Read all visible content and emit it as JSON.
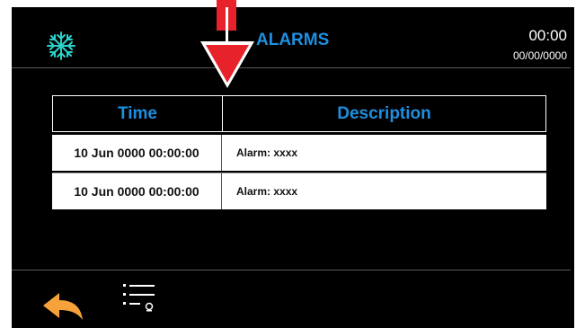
{
  "header": {
    "title": "ALARMS",
    "time": "00:00",
    "date": "00/00/0000"
  },
  "table": {
    "columns": [
      "Time",
      "Description"
    ],
    "rows": [
      {
        "time": "10 Jun 0000 00:00:00",
        "description": "Alarm: xxxx"
      },
      {
        "time": "10 Jun 0000 00:00:00",
        "description": "Alarm: xxxx"
      }
    ]
  },
  "icons": {
    "status": "snowflake-icon",
    "back": "back-arrow-icon",
    "menu": "list-menu-icon",
    "annotation": "red-down-arrow"
  },
  "colors": {
    "accent": "#1e8fe0",
    "back_arrow": "#f5a23a",
    "annotation": "#e8222b"
  }
}
